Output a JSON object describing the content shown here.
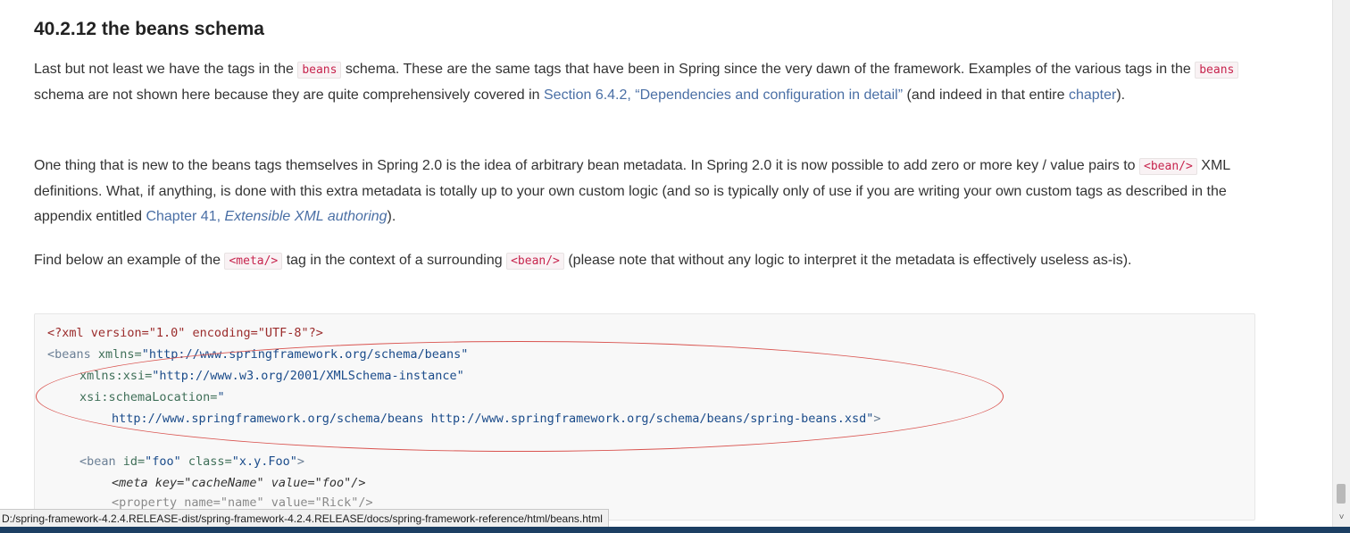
{
  "section": {
    "title": "40.2.12 the beans schema"
  },
  "paragraph1": {
    "t1": "Last but not least we have the tags in the ",
    "code_beans": "beans",
    "t2": " schema. These are the same tags that have been in Spring since the very dawn of the framework. Examples of the various tags in the ",
    "code_beans_2": "beans",
    "t3": " schema are not shown here because they are quite comprehensively covered in ",
    "link_section": "Section 6.4.2, “Dependencies and configuration in detail”",
    "t4": " (and indeed in that entire ",
    "link_chapter": "chapter",
    "t5": ")."
  },
  "paragraph2": {
    "t1": "One thing that is new to the beans tags themselves in Spring 2.0 is the idea of arbitrary bean metadata. In Spring 2.0 it is now possible to add zero or more key / value pairs to ",
    "code_bean": "<bean/>",
    "t2": " XML definitions. What, if anything, is done with this extra metadata is totally up to your own custom logic (and so is typically only of use if you are writing your own custom tags as described in the appendix entitled ",
    "link_chapter41": "Chapter 41, ",
    "link_chapter41_title": "Extensible XML authoring",
    "t3": ")."
  },
  "paragraph3": {
    "t1": "Find below an example of the ",
    "code_meta": "<meta/>",
    "t2": " tag in the context of a surrounding ",
    "code_bean": "<bean/>",
    "t3": " (please note that without any logic to interpret it the metadata is effectively useless as-is)."
  },
  "code": {
    "l1": "<?xml version=\"1.0\" encoding=\"UTF-8\"?>",
    "l2_tag": "<beans",
    "l2_attr": " xmlns=",
    "l2_val": "\"http://www.springframework.org/schema/beans\"",
    "l3_attr": "xmlns:xsi=",
    "l3_val": "\"http://www.w3.org/2001/XMLSchema-instance\"",
    "l4_attr": "xsi:schemaLocation=",
    "l4_val": "\"",
    "l5_val": "http://www.springframework.org/schema/beans http://www.springframework.org/schema/beans/spring-beans.xsd\"",
    "l5_tag": ">",
    "l7_tag": "<bean",
    "l7_attr1": " id=",
    "l7_val1": "\"foo\"",
    "l7_attr2": " class=",
    "l7_val2": "\"x.y.Foo\"",
    "l7_end": ">",
    "l8": "<meta key=\"cacheName\" value=\"foo\"/>",
    "l9": "<property name=\"name\" value=\"Rick\"/>"
  },
  "status_bar": {
    "url": "D:/spring-framework-4.2.4.RELEASE-dist/spring-framework-4.2.4.RELEASE/docs/spring-framework-reference/html/beans.html"
  },
  "scrollbar": {
    "down_arrow": "˅"
  },
  "colors": {
    "link": "#4a6fa5",
    "code_literal": "#c7254e",
    "annotation": "#d9534f"
  }
}
